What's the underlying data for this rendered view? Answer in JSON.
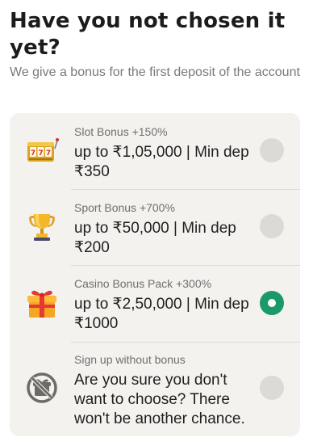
{
  "header": {
    "title": "Have you not chosen it yet?",
    "subtitle": "We give a bonus for the first deposit of the account"
  },
  "options": [
    {
      "label": "Slot Bonus +150%",
      "description": "up to ₹1,05,000 | Min dep ₹350",
      "icon": "slot-machine-icon",
      "selected": false
    },
    {
      "label": "Sport Bonus +700%",
      "description": "up to ₹50,000 | Min dep ₹200",
      "icon": "trophy-icon",
      "selected": false
    },
    {
      "label": "Casino Bonus Pack +300%",
      "description": "up to ₹2,50,000 | Min dep ₹1000",
      "icon": "gift-box-icon",
      "selected": true
    },
    {
      "label": "Sign up without bonus",
      "description": "Are you sure you don't want to choose? There won't be another chance.",
      "icon": "no-bonus-icon",
      "selected": false
    }
  ],
  "colors": {
    "accent": "#1a9a69",
    "card_background": "#f3f2ef",
    "radio_unselected": "#dcdad4"
  }
}
